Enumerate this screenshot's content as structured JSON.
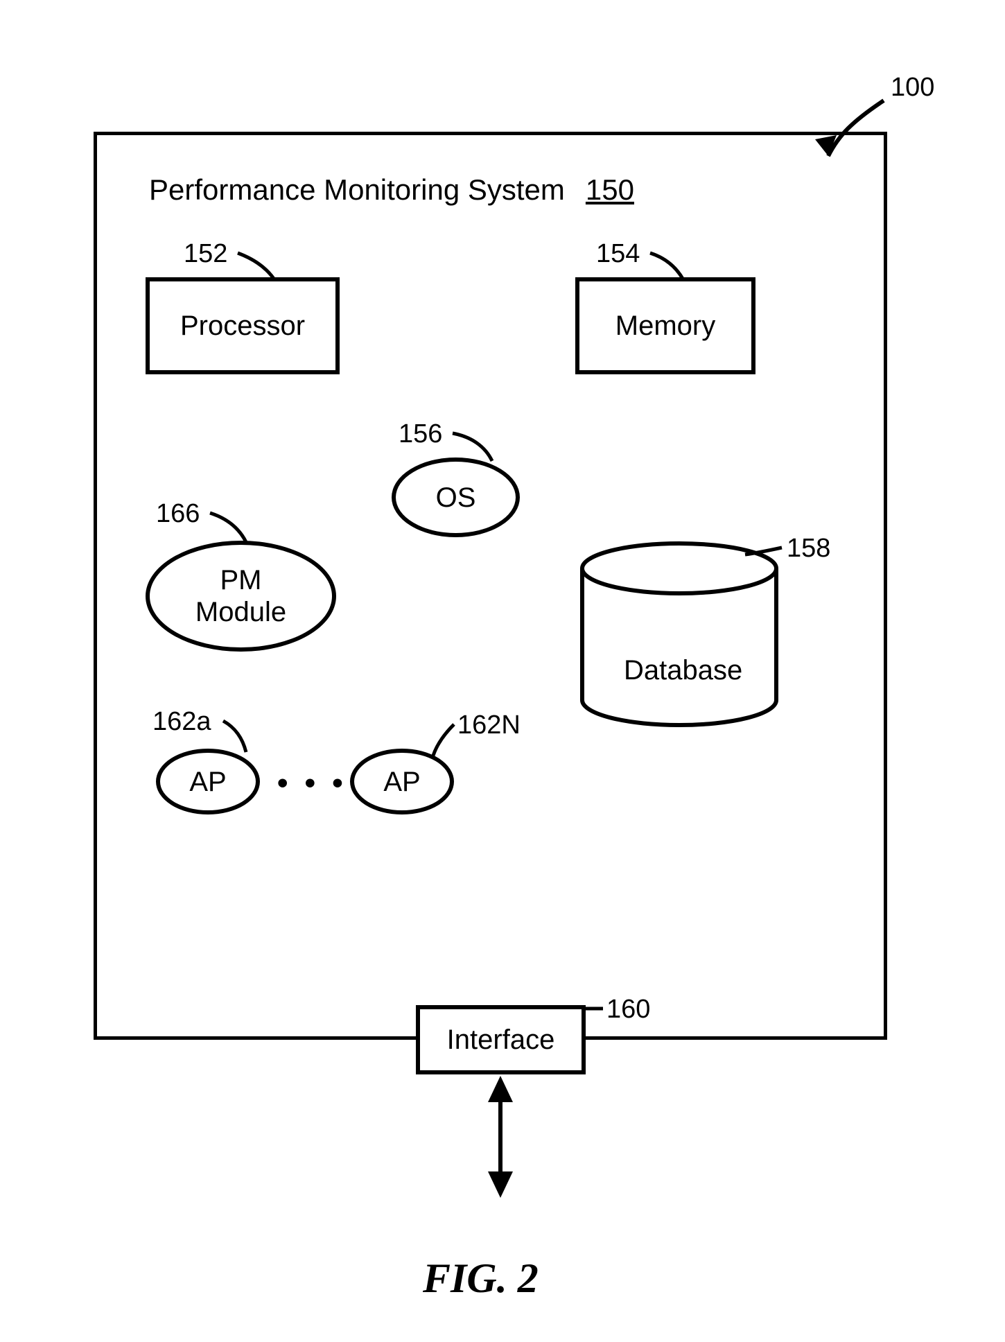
{
  "figure": {
    "caption": "FIG. 2",
    "outer_ref": "100",
    "title": "Performance Monitoring System",
    "title_ref": "150"
  },
  "blocks": {
    "processor": {
      "label": "Processor",
      "ref": "152"
    },
    "memory": {
      "label": "Memory",
      "ref": "154"
    },
    "os": {
      "label": "OS",
      "ref": "156"
    },
    "pm": {
      "label": "PM\nModule",
      "ref": "166"
    },
    "database": {
      "label": "Database",
      "ref": "158"
    },
    "ap_first": {
      "label": "AP",
      "ref": "162a"
    },
    "ap_last": {
      "label": "AP",
      "ref": "162N"
    },
    "ap_dots": "• • •",
    "interface": {
      "label": "Interface",
      "ref": "160"
    }
  }
}
